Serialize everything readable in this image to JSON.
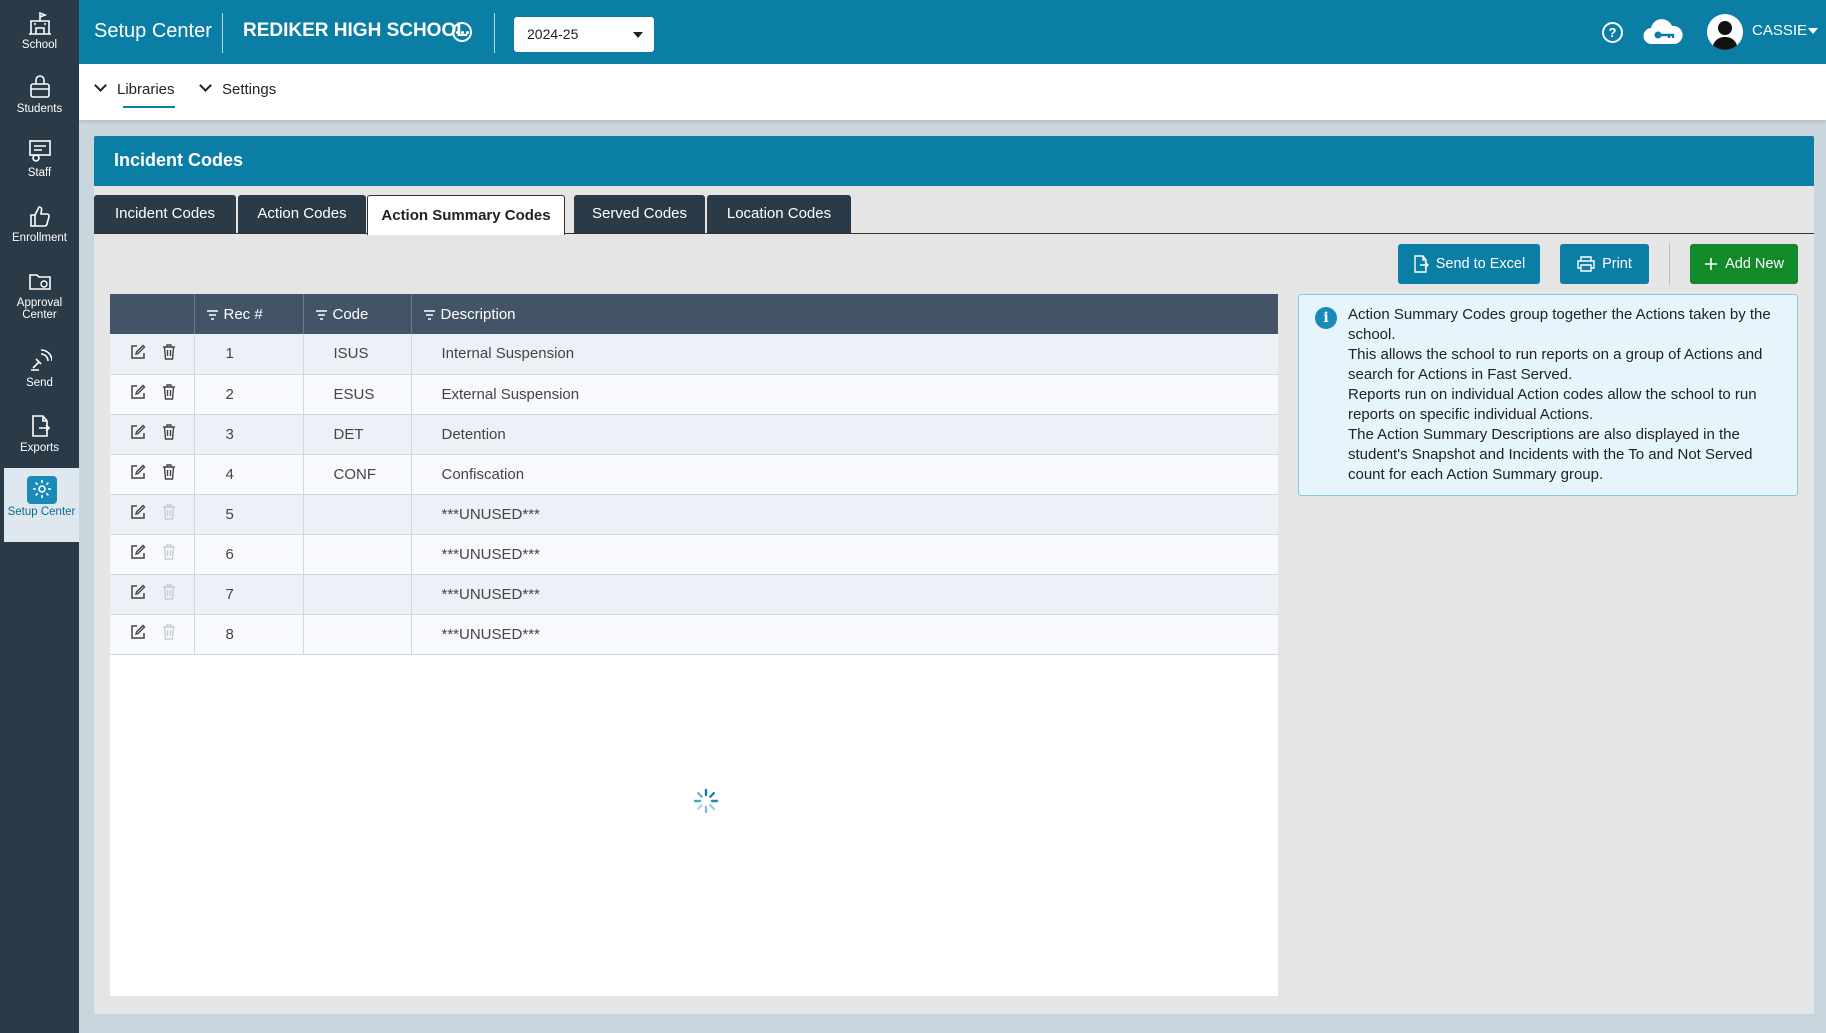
{
  "sidebar": {
    "items": [
      {
        "label": "School",
        "icon": "school-icon"
      },
      {
        "label": "Students",
        "icon": "students-icon"
      },
      {
        "label": "Staff",
        "icon": "staff-icon"
      },
      {
        "label": "Enrollment",
        "icon": "thumbs-up-icon"
      },
      {
        "label": "Approval Center",
        "icon": "folder-icon"
      },
      {
        "label": "Send",
        "icon": "satellite-icon"
      },
      {
        "label": "Exports",
        "icon": "export-icon"
      },
      {
        "label": "Setup Center",
        "icon": "gear-icon",
        "active": true
      }
    ]
  },
  "topbar": {
    "app_title": "Setup Center",
    "school_name": "REDIKER HIGH SCHOOL",
    "year": "2024-25",
    "user_name": "CASSIE"
  },
  "nav": {
    "items": [
      "Libraries",
      "Settings"
    ]
  },
  "panel": {
    "title": "Incident Codes",
    "tabs": [
      "Incident Codes",
      "Action Codes",
      "Action Summary Codes",
      "Served Codes",
      "Location Codes"
    ],
    "active_tab": "Action Summary Codes",
    "buttons": {
      "send_to_excel": "Send to Excel",
      "print": "Print",
      "add_new": "Add New"
    }
  },
  "table": {
    "columns": [
      "Rec #",
      "Code",
      "Description"
    ],
    "rows": [
      {
        "rec": "1",
        "code": "ISUS",
        "desc": "Internal Suspension",
        "deletable": true
      },
      {
        "rec": "2",
        "code": "ESUS",
        "desc": "External Suspension",
        "deletable": true
      },
      {
        "rec": "3",
        "code": "DET",
        "desc": "Detention",
        "deletable": true
      },
      {
        "rec": "4",
        "code": "CONF",
        "desc": "Confiscation",
        "deletable": true
      },
      {
        "rec": "5",
        "code": "",
        "desc": "***UNUSED***",
        "deletable": false
      },
      {
        "rec": "6",
        "code": "",
        "desc": "***UNUSED***",
        "deletable": false
      },
      {
        "rec": "7",
        "code": "",
        "desc": "***UNUSED***",
        "deletable": false
      },
      {
        "rec": "8",
        "code": "",
        "desc": "***UNUSED***",
        "deletable": false
      }
    ]
  },
  "info": {
    "lines": [
      "Action Summary Codes group together the Actions taken by the school.",
      "This allows the school to run reports on a group of Actions and search for Actions in Fast Served.",
      "Reports run on individual Action codes allow the school to run reports on specific individual Actions.",
      "The Action Summary Descriptions are also displayed in the student's Snapshot and Incidents with the To and Not Served count for each Action Summary group."
    ]
  },
  "colors": {
    "brand": "#0b7ea5",
    "sidebar": "#2b3a47",
    "add_button": "#138a2a",
    "table_header": "#425466"
  }
}
